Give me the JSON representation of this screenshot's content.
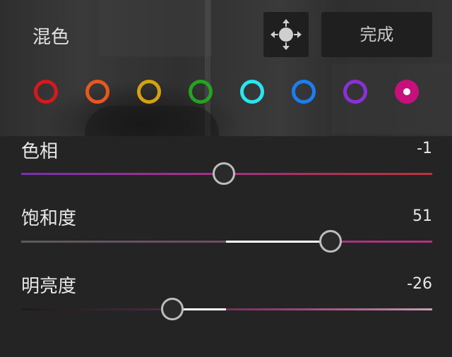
{
  "header": {
    "title": "混色",
    "done_label": "完成",
    "target_icon": "move-target-icon"
  },
  "color_swatches": [
    {
      "name": "red",
      "color": "#d8181b",
      "selected": false
    },
    {
      "name": "orange",
      "color": "#e8581e",
      "selected": false
    },
    {
      "name": "yellow",
      "color": "#d4a20e",
      "selected": false
    },
    {
      "name": "green",
      "color": "#25a21f",
      "selected": false
    },
    {
      "name": "aqua",
      "color": "#28e6f0",
      "selected": false
    },
    {
      "name": "blue",
      "color": "#1a7ef2",
      "selected": false
    },
    {
      "name": "purple",
      "color": "#8a30d6",
      "selected": false
    },
    {
      "name": "magenta",
      "color": "#c8107c",
      "selected": true
    }
  ],
  "sliders": {
    "hue": {
      "label": "色相",
      "value": "-1",
      "position": 0.495
    },
    "saturation": {
      "label": "饱和度",
      "value": "51",
      "position": 0.755
    },
    "luminance": {
      "label": "明亮度",
      "value": "-26",
      "position": 0.37
    }
  }
}
